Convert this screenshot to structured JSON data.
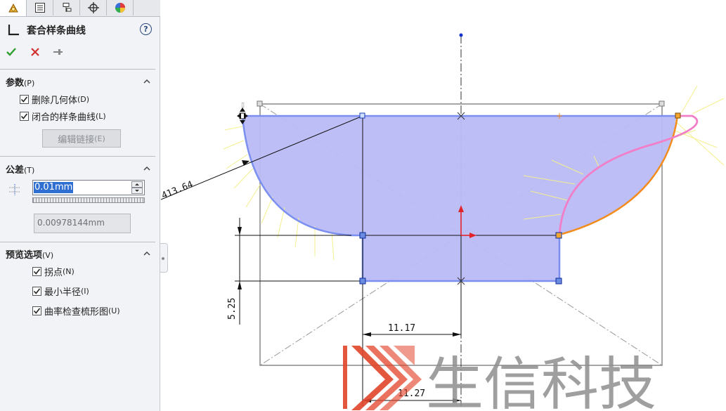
{
  "panel": {
    "title": "套合样条曲线",
    "help_label": "?",
    "sections": {
      "params": {
        "title": "参数",
        "shortcut": "(P)",
        "checkboxes": [
          {
            "label": "删除几何体",
            "shortcut": "(D)",
            "checked": true
          },
          {
            "label": "闭合的样条曲线",
            "shortcut": "(L)",
            "checked": true
          }
        ],
        "edit_button": {
          "label": "编辑链接",
          "shortcut": "(E)"
        }
      },
      "tolerance": {
        "title": "公差",
        "shortcut": "(T)",
        "value": "0.01mm",
        "readout": "0.00978144mm"
      },
      "preview": {
        "title": "预览选项",
        "shortcut": "(V)",
        "checkboxes": [
          {
            "label": "拐点",
            "shortcut": "(N)",
            "checked": true
          },
          {
            "label": "最小半径",
            "shortcut": "(I)",
            "checked": true
          },
          {
            "label": "曲率检查梳形图",
            "shortcut": "(U)",
            "checked": true
          }
        ]
      }
    }
  },
  "dimensions": {
    "radius": "413.64",
    "vertical": "5.25",
    "horizontal_1": "11.17",
    "horizontal_2": "11.27"
  },
  "watermark": {
    "text": "生信科技"
  },
  "colors": {
    "fill": "#babaf7",
    "outline": "#7a8ff0",
    "spline_pink": "#f07fc8",
    "spline_orange": "#f28c1c",
    "comb": "#f4ef8c",
    "accept": "#2e9e2e",
    "cancel": "#d23030",
    "logo_red": "#e2452b",
    "watermark_gray": "#8e8e8e"
  }
}
